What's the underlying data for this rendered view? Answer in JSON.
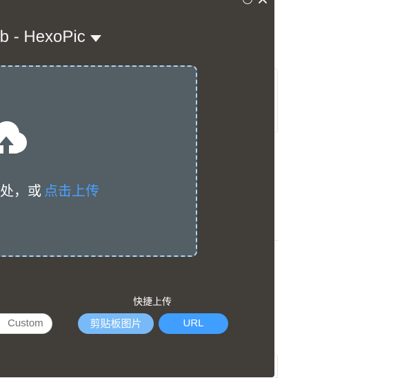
{
  "window": {
    "controls": {
      "minimize_icon": "minimize-circle-icon",
      "close_icon": "close-icon"
    }
  },
  "header": {
    "picbed_title": "lub - HexoPic",
    "dropdown_icon": "chevron-down-icon"
  },
  "upload": {
    "icon": "cloud-upload-icon",
    "hint_prefix": "处，或",
    "link_text": "点击上传"
  },
  "quick_upload": {
    "title": "快捷上传",
    "custom_label": "Custom",
    "clipboard_label": "剪贴板图片",
    "url_label": "URL"
  },
  "colors": {
    "window_background": "#413d39",
    "drop_zone_background": "#535e65",
    "drop_zone_border": "#abd4f5",
    "primary": "#409eff",
    "primary_light": "#78b9f8",
    "link": "#4aa3ff"
  }
}
